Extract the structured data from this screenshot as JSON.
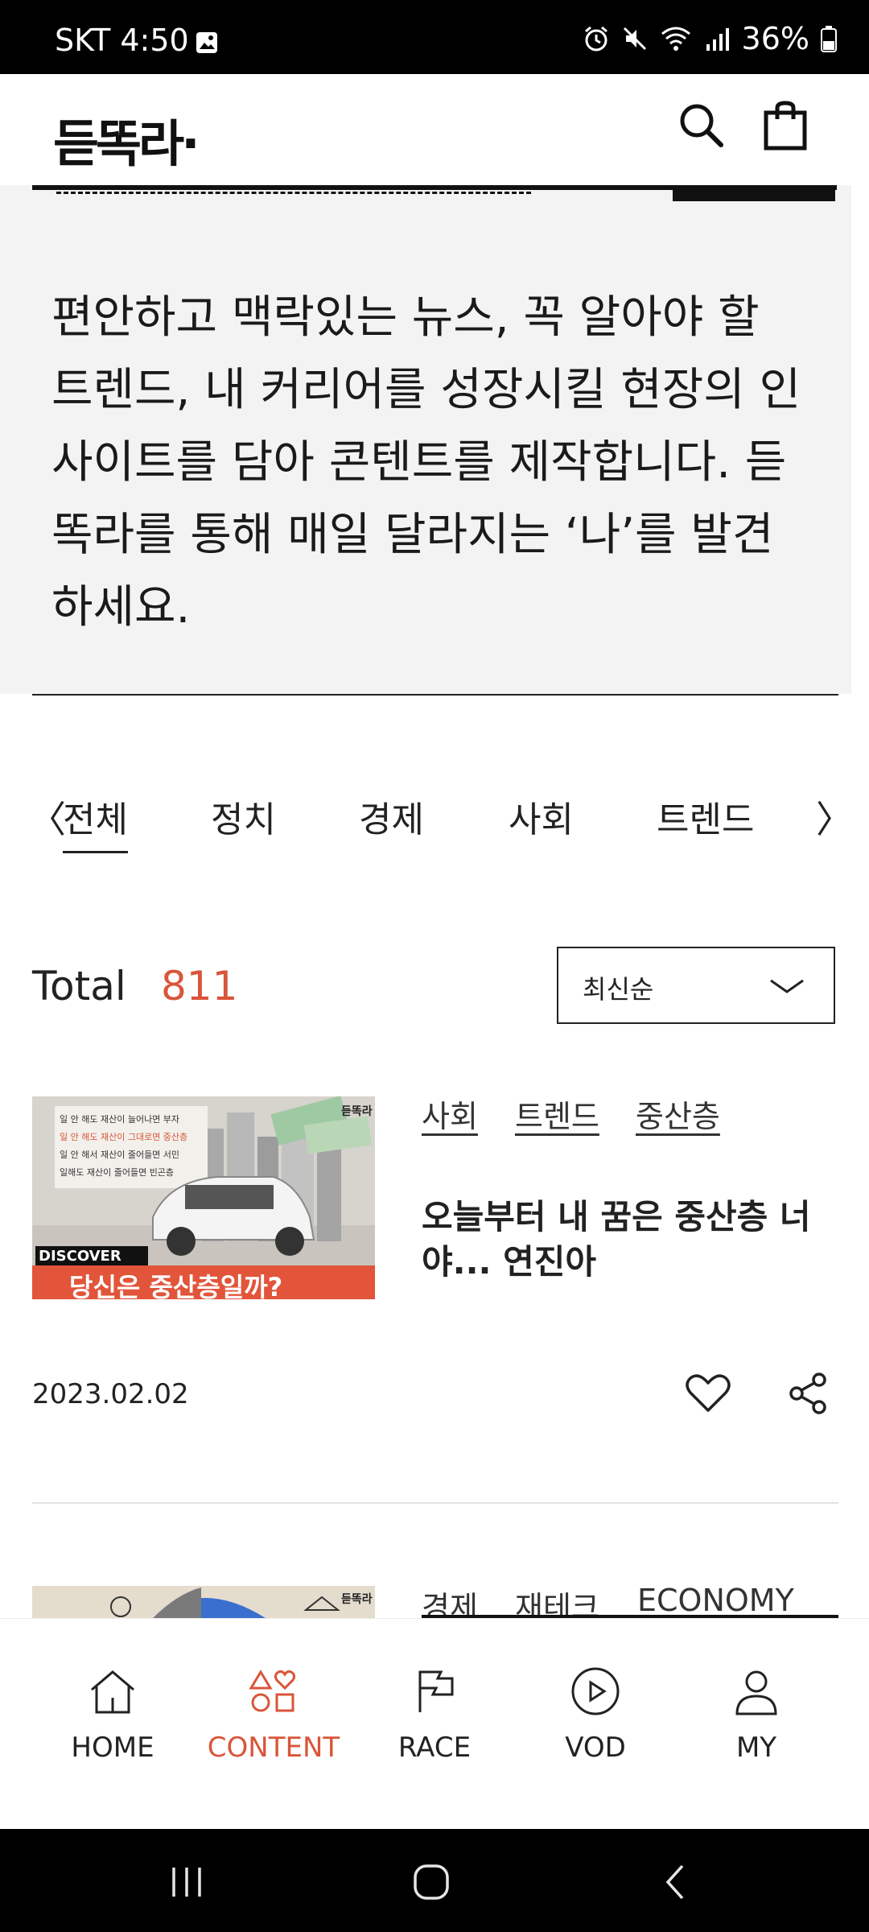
{
  "status_bar": {
    "carrier_time": "SKT 4:50",
    "battery": "36%",
    "icons": [
      "image-icon",
      "alarm-icon",
      "mute-icon",
      "wifi-icon",
      "signal-icon",
      "battery-icon"
    ]
  },
  "header": {
    "logo": "듣똑라·",
    "icons": [
      "search-icon",
      "shopping-bag-icon"
    ]
  },
  "intro": {
    "text": "편안하고 맥락있는 뉴스, 꼭 알아야 할 트렌드, 내 커리어를 성장시킬 현장의 인사이트를 담아 콘텐트를 제작합니다. 듣똑라를 통해 매일 달라지는 ‘나’를 발견하세요."
  },
  "tabs": {
    "prev_arrow": "〈",
    "next_arrow": "〉",
    "items": [
      {
        "label": "전체",
        "active": true
      },
      {
        "label": "정치",
        "active": false
      },
      {
        "label": "경제",
        "active": false
      },
      {
        "label": "사회",
        "active": false
      },
      {
        "label": "트렌드",
        "active": false
      }
    ]
  },
  "total": {
    "label": "Total",
    "count": "811"
  },
  "sort": {
    "selected": "최신순"
  },
  "articles": [
    {
      "thumb": {
        "brand": "듣똑라",
        "lines": [
          "일 안 해도 재산이 늘어나면 부자",
          "일 안 해도 재산이 그대로면 중산층",
          "일 안 해서 재산이 줄어들면 서민",
          "일해도 재산이 줄어들면 빈곤층"
        ],
        "badge": "DISCOVER",
        "headline": "당신은 중산층일까?"
      },
      "tags": [
        "사회",
        "트렌드",
        "중산층"
      ],
      "title": "오늘부터 내 꿈은 중산층 너야... 연진아",
      "date": "2023.02.02"
    },
    {
      "thumb": {
        "brand": "듣똑라"
      },
      "tags": [
        "경제",
        "재테크",
        "ECONOMY"
      ]
    }
  ],
  "bottom_nav": {
    "items": [
      {
        "label": "HOME",
        "icon": "home-icon",
        "active": false
      },
      {
        "label": "CONTENT",
        "icon": "content-icon",
        "active": true
      },
      {
        "label": "RACE",
        "icon": "flag-icon",
        "active": false
      },
      {
        "label": "VOD",
        "icon": "play-icon",
        "active": false
      },
      {
        "label": "MY",
        "icon": "user-icon",
        "active": false
      }
    ]
  },
  "colors": {
    "accent": "#d9553a",
    "text": "#222222",
    "intro_bg": "#f3f3f3"
  }
}
